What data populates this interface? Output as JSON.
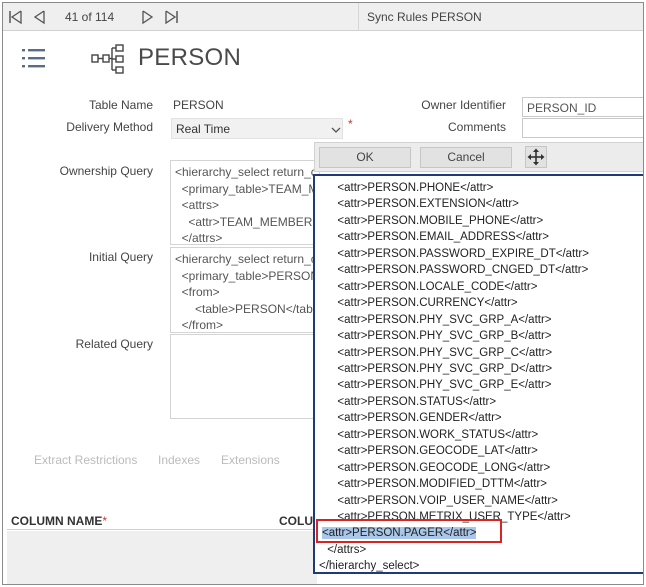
{
  "toolbar": {
    "record_count": "41 of 114",
    "window_title": "Sync Rules PERSON",
    "icons": [
      "first-record-icon",
      "previous-record-icon",
      "next-record-icon",
      "last-record-icon"
    ]
  },
  "header": {
    "title": "PERSON",
    "icons": [
      "hamburger-menu-icon",
      "hierarchy-icon"
    ]
  },
  "form": {
    "table_name_label": "Table Name",
    "table_name_value": "PERSON",
    "delivery_method_label": "Delivery Method",
    "delivery_method_value": "Real Time",
    "required_mark": "*",
    "owner_identifier_label": "Owner Identifier",
    "owner_identifier_value": "PERSON_ID",
    "comments_label": "Comments",
    "comments_value": "",
    "ownership_query_label": "Ownership Query",
    "ownership_query_text": "<hierarchy_select return_c\n  <primary_table>TEAM_M\n  <attrs>\n    <attr>TEAM_MEMBER.\n  </attrs>",
    "initial_query_label": "Initial Query",
    "initial_query_text": "<hierarchy_select return_c\n  <primary_table>PERSON\n  <from>\n      <table>PERSON</tab\n  </from>",
    "related_query_label": "Related Query",
    "related_query_text": ""
  },
  "tabs": [
    "Extract Restrictions",
    "Indexes",
    "Extensions"
  ],
  "grid": {
    "col1": "COLUMN NAME",
    "col1_required": "*",
    "col2": "COLU"
  },
  "popup": {
    "ok_label": "OK",
    "cancel_label": "Cancel",
    "move_icon": "move-icon",
    "lines": [
      "  <attr>PERSON.PHONE</attr>",
      "  <attr>PERSON.EXTENSION</attr>",
      "  <attr>PERSON.MOBILE_PHONE</attr>",
      "  <attr>PERSON.EMAIL_ADDRESS</attr>",
      "  <attr>PERSON.PASSWORD_EXPIRE_DT</attr>",
      "  <attr>PERSON.PASSWORD_CNGED_DT</attr>",
      "  <attr>PERSON.LOCALE_CODE</attr>",
      "  <attr>PERSON.CURRENCY</attr>",
      "  <attr>PERSON.PHY_SVC_GRP_A</attr>",
      "  <attr>PERSON.PHY_SVC_GRP_B</attr>",
      "  <attr>PERSON.PHY_SVC_GRP_C</attr>",
      "  <attr>PERSON.PHY_SVC_GRP_D</attr>",
      "  <attr>PERSON.PHY_SVC_GRP_E</attr>",
      "  <attr>PERSON.STATUS</attr>",
      "  <attr>PERSON.GENDER</attr>",
      "  <attr>PERSON.WORK_STATUS</attr>",
      "  <attr>PERSON.GEOCODE_LAT</attr>",
      "  <attr>PERSON.GEOCODE_LONG</attr>",
      "  <attr>PERSON.MODIFIED_DTTM</attr>",
      "  <attr>PERSON.VOIP_USER_NAME</attr>",
      "  <attr>PERSON.METRIX_USER_TYPE</attr>",
      "<attr>PERSON.PAGER</attr>",
      " </attrs>",
      "</hierarchy_select>"
    ],
    "highlighted_line": 21,
    "highlight_color": "#a8c7ea",
    "callout_color": "#dd2222"
  }
}
